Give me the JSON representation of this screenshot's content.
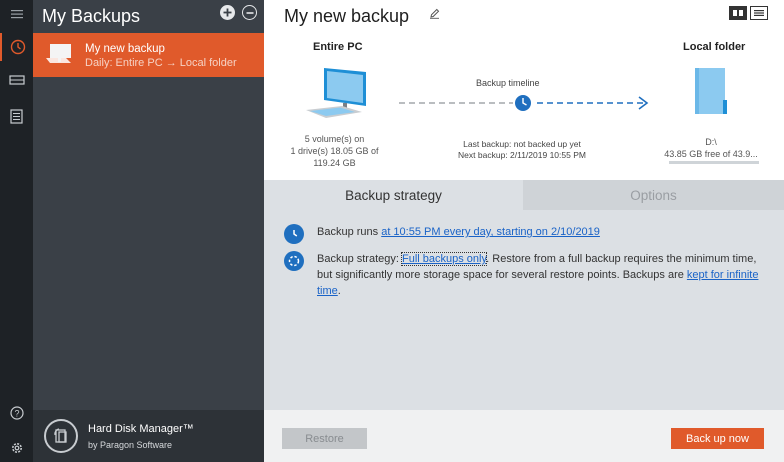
{
  "colors": {
    "accent": "#e05a2b",
    "link": "#1a63c7",
    "icon_blue": "#1f6fbf",
    "rail": "#1e2226",
    "list_bg": "#3a4047"
  },
  "rail": {
    "icons": [
      "menu-icon",
      "history-icon",
      "drive-icon",
      "log-icon",
      "help-icon",
      "settings-icon"
    ]
  },
  "backups": {
    "title": "My Backups",
    "items": [
      {
        "name": "My new backup",
        "description": "Daily: Entire PC → Local folder"
      }
    ]
  },
  "brand": {
    "name": "Hard Disk Manager™",
    "sub": "by Paragon Software"
  },
  "main": {
    "title": "My new backup",
    "source": {
      "label": "Entire PC",
      "info_line1": "5 volume(s) on",
      "info_line2": "1 drive(s) 18.05 GB of",
      "info_line3": "119.24 GB"
    },
    "timeline": {
      "label": "Backup timeline",
      "last": "Last backup: not backed up yet",
      "next": "Next backup: 2/11/2019 10:55 PM"
    },
    "destination": {
      "label": "Local folder",
      "path": "D:\\",
      "free": "43.85 GB free of 43.9..."
    },
    "tabs": [
      {
        "label": "Backup strategy"
      },
      {
        "label": "Options"
      }
    ],
    "strategy": {
      "runs_prefix": "Backup runs ",
      "runs_link": "at 10:55 PM every day, starting on 2/10/2019",
      "strategy_prefix": "Backup strategy: ",
      "strategy_link": "Full backups only",
      "strategy_text": ". Restore from a full backup requires the minimum time, but significantly more storage space for several restore points. Backups are ",
      "keep_link": "kept for infinite time",
      "strategy_suffix": "."
    },
    "footer": {
      "restore_label": "Restore",
      "backup_label": "Back up now"
    }
  }
}
